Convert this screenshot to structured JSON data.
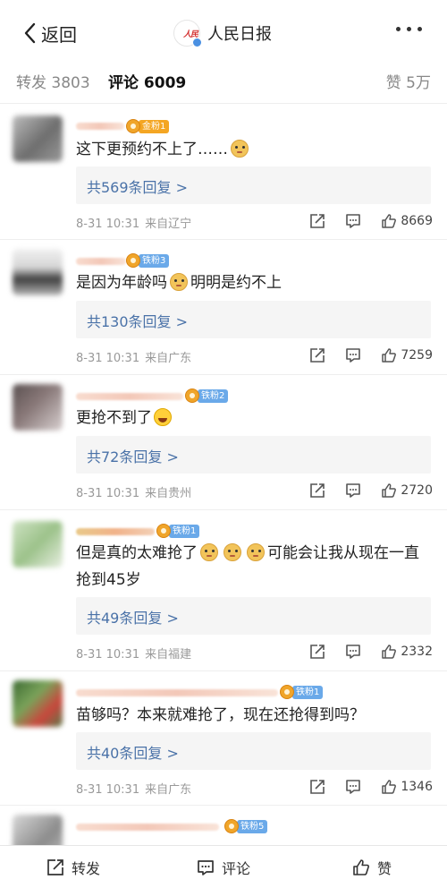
{
  "nav": {
    "back_label": "返回",
    "account_name": "人民日报"
  },
  "tabs": {
    "repost": "转发 3803",
    "comment": "评论 6009",
    "like": "赞 5万"
  },
  "comments": [
    {
      "badge": "金粉1",
      "text": "这下更预约不上了……",
      "replies": "共569条回复 >",
      "time": "8-31 10:31",
      "location": "来自辽宁",
      "likes": "8669"
    },
    {
      "badge": "铁粉3",
      "text_a": "是因为年龄吗",
      "text_b": "明明是约不上",
      "replies": "共130条回复 >",
      "time": "8-31 10:31",
      "location": "来自广东",
      "likes": "7259"
    },
    {
      "badge": "铁粉2",
      "text": "更抢不到了",
      "replies": "共72条回复 >",
      "time": "8-31 10:31",
      "location": "来自贵州",
      "likes": "2720"
    },
    {
      "badge": "铁粉1",
      "text_a": "但是真的太难抢了",
      "text_b": "可能会让我从现在一直抢到45岁",
      "replies": "共49条回复 >",
      "time": "8-31 10:31",
      "location": "来自福建",
      "likes": "2332"
    },
    {
      "badge": "铁粉1",
      "text": "苗够吗？本来就难抢了，现在还抢得到吗？",
      "replies": "共40条回复 >",
      "time": "8-31 10:31",
      "location": "来自广东",
      "likes": "1346"
    },
    {
      "badge": "铁粉5"
    }
  ],
  "bottom_bar": {
    "repost": "转发",
    "comment": "评论",
    "like": "赞"
  },
  "colors": {
    "reply_link": "#4a72a8",
    "gold_badge": "#f4a623",
    "fan_badge": "#6aa9e9"
  }
}
